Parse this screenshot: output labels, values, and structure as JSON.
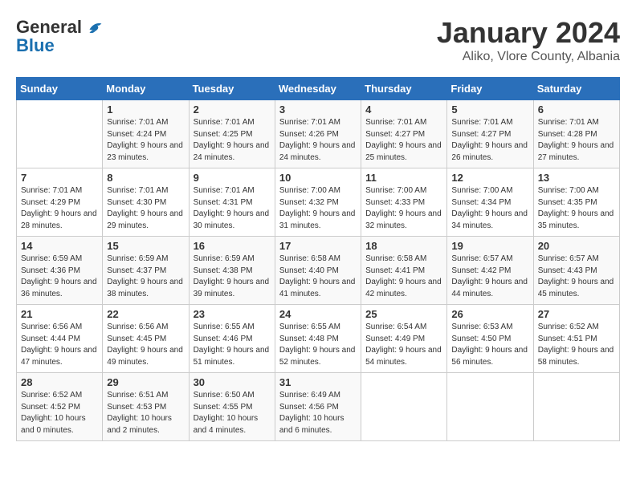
{
  "header": {
    "logo_line1": "General",
    "logo_line2": "Blue",
    "title": "January 2024",
    "location": "Aliko, Vlore County, Albania"
  },
  "weekdays": [
    "Sunday",
    "Monday",
    "Tuesday",
    "Wednesday",
    "Thursday",
    "Friday",
    "Saturday"
  ],
  "weeks": [
    [
      {
        "day": "",
        "sunrise": "",
        "sunset": "",
        "daylight": ""
      },
      {
        "day": "1",
        "sunrise": "Sunrise: 7:01 AM",
        "sunset": "Sunset: 4:24 PM",
        "daylight": "Daylight: 9 hours and 23 minutes."
      },
      {
        "day": "2",
        "sunrise": "Sunrise: 7:01 AM",
        "sunset": "Sunset: 4:25 PM",
        "daylight": "Daylight: 9 hours and 24 minutes."
      },
      {
        "day": "3",
        "sunrise": "Sunrise: 7:01 AM",
        "sunset": "Sunset: 4:26 PM",
        "daylight": "Daylight: 9 hours and 24 minutes."
      },
      {
        "day": "4",
        "sunrise": "Sunrise: 7:01 AM",
        "sunset": "Sunset: 4:27 PM",
        "daylight": "Daylight: 9 hours and 25 minutes."
      },
      {
        "day": "5",
        "sunrise": "Sunrise: 7:01 AM",
        "sunset": "Sunset: 4:27 PM",
        "daylight": "Daylight: 9 hours and 26 minutes."
      },
      {
        "day": "6",
        "sunrise": "Sunrise: 7:01 AM",
        "sunset": "Sunset: 4:28 PM",
        "daylight": "Daylight: 9 hours and 27 minutes."
      }
    ],
    [
      {
        "day": "7",
        "sunrise": "Sunrise: 7:01 AM",
        "sunset": "Sunset: 4:29 PM",
        "daylight": "Daylight: 9 hours and 28 minutes."
      },
      {
        "day": "8",
        "sunrise": "Sunrise: 7:01 AM",
        "sunset": "Sunset: 4:30 PM",
        "daylight": "Daylight: 9 hours and 29 minutes."
      },
      {
        "day": "9",
        "sunrise": "Sunrise: 7:01 AM",
        "sunset": "Sunset: 4:31 PM",
        "daylight": "Daylight: 9 hours and 30 minutes."
      },
      {
        "day": "10",
        "sunrise": "Sunrise: 7:00 AM",
        "sunset": "Sunset: 4:32 PM",
        "daylight": "Daylight: 9 hours and 31 minutes."
      },
      {
        "day": "11",
        "sunrise": "Sunrise: 7:00 AM",
        "sunset": "Sunset: 4:33 PM",
        "daylight": "Daylight: 9 hours and 32 minutes."
      },
      {
        "day": "12",
        "sunrise": "Sunrise: 7:00 AM",
        "sunset": "Sunset: 4:34 PM",
        "daylight": "Daylight: 9 hours and 34 minutes."
      },
      {
        "day": "13",
        "sunrise": "Sunrise: 7:00 AM",
        "sunset": "Sunset: 4:35 PM",
        "daylight": "Daylight: 9 hours and 35 minutes."
      }
    ],
    [
      {
        "day": "14",
        "sunrise": "Sunrise: 6:59 AM",
        "sunset": "Sunset: 4:36 PM",
        "daylight": "Daylight: 9 hours and 36 minutes."
      },
      {
        "day": "15",
        "sunrise": "Sunrise: 6:59 AM",
        "sunset": "Sunset: 4:37 PM",
        "daylight": "Daylight: 9 hours and 38 minutes."
      },
      {
        "day": "16",
        "sunrise": "Sunrise: 6:59 AM",
        "sunset": "Sunset: 4:38 PM",
        "daylight": "Daylight: 9 hours and 39 minutes."
      },
      {
        "day": "17",
        "sunrise": "Sunrise: 6:58 AM",
        "sunset": "Sunset: 4:40 PM",
        "daylight": "Daylight: 9 hours and 41 minutes."
      },
      {
        "day": "18",
        "sunrise": "Sunrise: 6:58 AM",
        "sunset": "Sunset: 4:41 PM",
        "daylight": "Daylight: 9 hours and 42 minutes."
      },
      {
        "day": "19",
        "sunrise": "Sunrise: 6:57 AM",
        "sunset": "Sunset: 4:42 PM",
        "daylight": "Daylight: 9 hours and 44 minutes."
      },
      {
        "day": "20",
        "sunrise": "Sunrise: 6:57 AM",
        "sunset": "Sunset: 4:43 PM",
        "daylight": "Daylight: 9 hours and 45 minutes."
      }
    ],
    [
      {
        "day": "21",
        "sunrise": "Sunrise: 6:56 AM",
        "sunset": "Sunset: 4:44 PM",
        "daylight": "Daylight: 9 hours and 47 minutes."
      },
      {
        "day": "22",
        "sunrise": "Sunrise: 6:56 AM",
        "sunset": "Sunset: 4:45 PM",
        "daylight": "Daylight: 9 hours and 49 minutes."
      },
      {
        "day": "23",
        "sunrise": "Sunrise: 6:55 AM",
        "sunset": "Sunset: 4:46 PM",
        "daylight": "Daylight: 9 hours and 51 minutes."
      },
      {
        "day": "24",
        "sunrise": "Sunrise: 6:55 AM",
        "sunset": "Sunset: 4:48 PM",
        "daylight": "Daylight: 9 hours and 52 minutes."
      },
      {
        "day": "25",
        "sunrise": "Sunrise: 6:54 AM",
        "sunset": "Sunset: 4:49 PM",
        "daylight": "Daylight: 9 hours and 54 minutes."
      },
      {
        "day": "26",
        "sunrise": "Sunrise: 6:53 AM",
        "sunset": "Sunset: 4:50 PM",
        "daylight": "Daylight: 9 hours and 56 minutes."
      },
      {
        "day": "27",
        "sunrise": "Sunrise: 6:52 AM",
        "sunset": "Sunset: 4:51 PM",
        "daylight": "Daylight: 9 hours and 58 minutes."
      }
    ],
    [
      {
        "day": "28",
        "sunrise": "Sunrise: 6:52 AM",
        "sunset": "Sunset: 4:52 PM",
        "daylight": "Daylight: 10 hours and 0 minutes."
      },
      {
        "day": "29",
        "sunrise": "Sunrise: 6:51 AM",
        "sunset": "Sunset: 4:53 PM",
        "daylight": "Daylight: 10 hours and 2 minutes."
      },
      {
        "day": "30",
        "sunrise": "Sunrise: 6:50 AM",
        "sunset": "Sunset: 4:55 PM",
        "daylight": "Daylight: 10 hours and 4 minutes."
      },
      {
        "day": "31",
        "sunrise": "Sunrise: 6:49 AM",
        "sunset": "Sunset: 4:56 PM",
        "daylight": "Daylight: 10 hours and 6 minutes."
      },
      {
        "day": "",
        "sunrise": "",
        "sunset": "",
        "daylight": ""
      },
      {
        "day": "",
        "sunrise": "",
        "sunset": "",
        "daylight": ""
      },
      {
        "day": "",
        "sunrise": "",
        "sunset": "",
        "daylight": ""
      }
    ]
  ]
}
